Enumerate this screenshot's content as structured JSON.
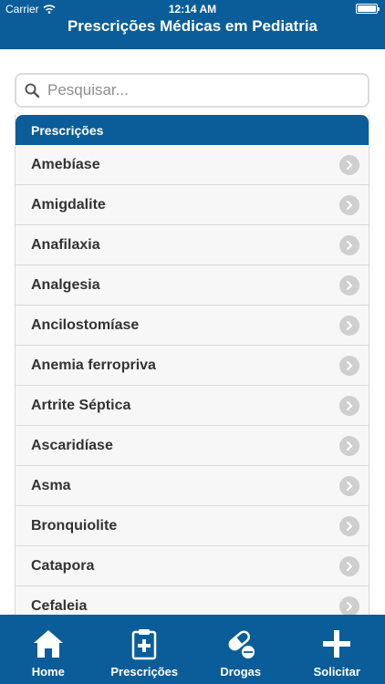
{
  "status": {
    "carrier": "Carrier",
    "time": "12:14 AM"
  },
  "header": {
    "title": "Prescrições Médicas em Pediatria"
  },
  "search": {
    "placeholder": "Pesquisar..."
  },
  "list": {
    "header": "Prescrições",
    "items": [
      {
        "label": "Amebíase"
      },
      {
        "label": "Amigdalite"
      },
      {
        "label": "Anafilaxia"
      },
      {
        "label": "Analgesia"
      },
      {
        "label": "Ancilostomíase"
      },
      {
        "label": "Anemia ferropriva"
      },
      {
        "label": "Artrite Séptica"
      },
      {
        "label": "Ascaridíase"
      },
      {
        "label": "Asma"
      },
      {
        "label": "Bronquiolite"
      },
      {
        "label": "Catapora"
      },
      {
        "label": "Cefaleia"
      }
    ]
  },
  "tabbar": {
    "tabs": [
      {
        "label": "Home",
        "icon": "home-icon"
      },
      {
        "label": "Prescrições",
        "icon": "clipboard-icon"
      },
      {
        "label": "Drogas",
        "icon": "pills-icon"
      },
      {
        "label": "Solicitar",
        "icon": "plus-icon"
      }
    ]
  },
  "colors": {
    "primary": "#0b5d99",
    "row_bg": "#f7f7f7",
    "chevron": "#cfcfcf"
  }
}
